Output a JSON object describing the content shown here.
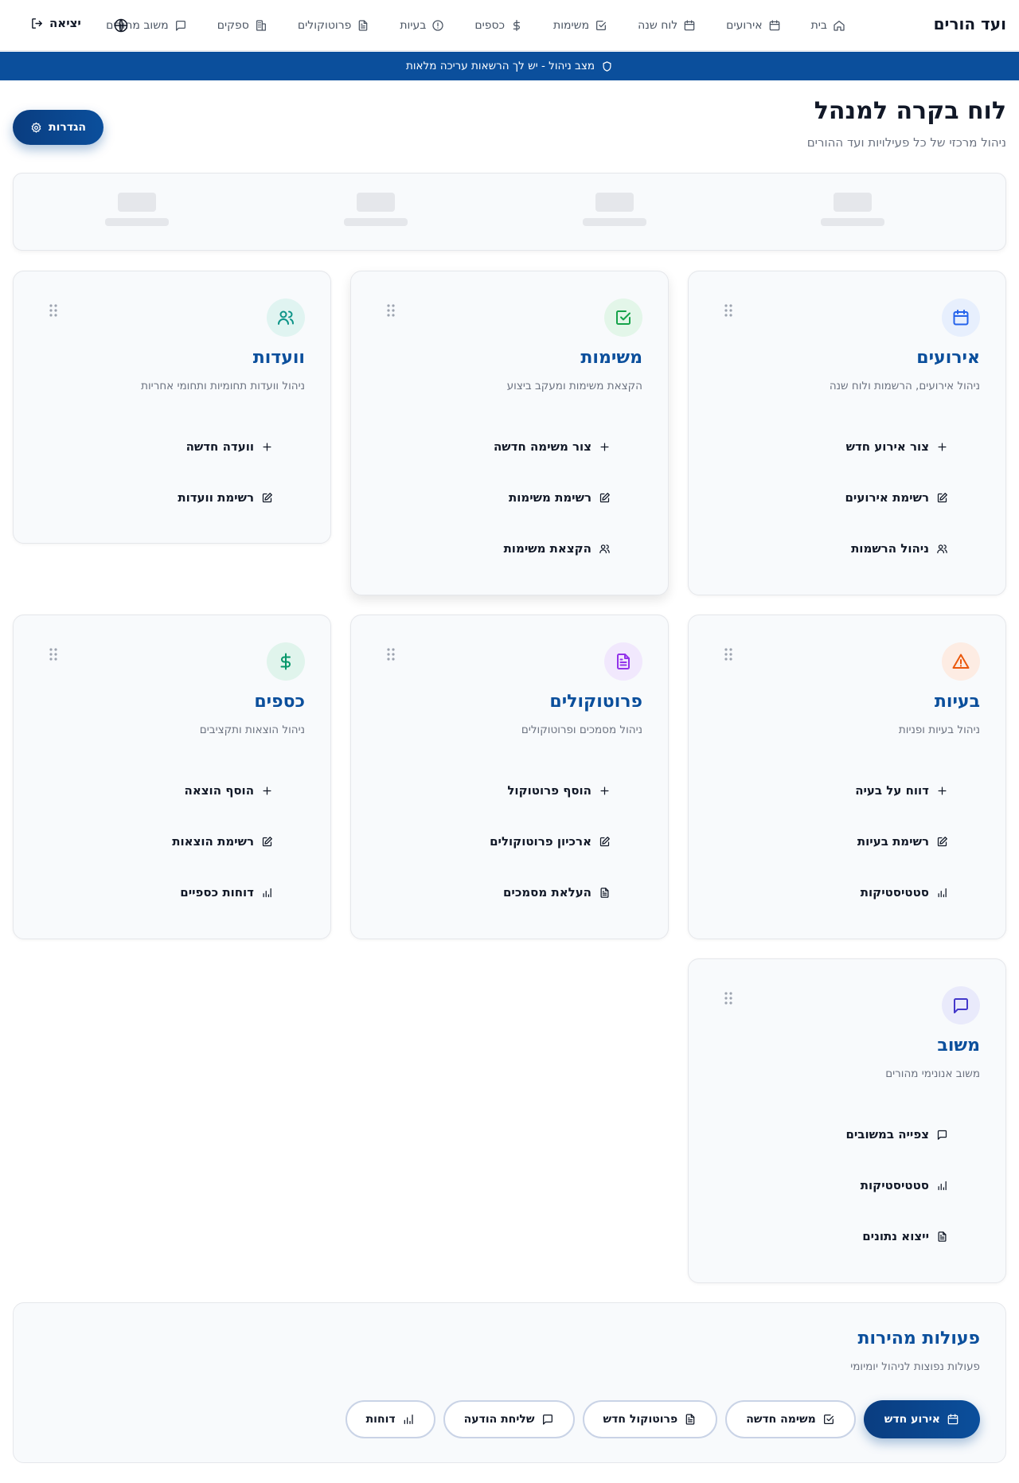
{
  "nav": {
    "brand": "ועד הורים",
    "items": [
      {
        "label": "בית",
        "icon": "home-icon"
      },
      {
        "label": "אירועים",
        "icon": "calendar-icon"
      },
      {
        "label": "לוח שנה",
        "icon": "calendar-icon"
      },
      {
        "label": "משימות",
        "icon": "checkbox-icon"
      },
      {
        "label": "כספים",
        "icon": "dollar-icon"
      },
      {
        "label": "בעיות",
        "icon": "alert-circle-icon"
      },
      {
        "label": "פרוטוקולים",
        "icon": "document-icon"
      },
      {
        "label": "ספקים",
        "icon": "building-icon"
      },
      {
        "label": "משוב מהורים",
        "icon": "message-icon"
      }
    ],
    "logout": "יציאה"
  },
  "banner": {
    "text": "מצב ניהול - יש לך הרשאות עריכה מלאות"
  },
  "header": {
    "title": "לוח בקרה למנהל",
    "subtitle": "ניהול מרכזי של כל פעילויות ועד ההורים",
    "settings": "הגדרות"
  },
  "cards": [
    {
      "title": "אירועים",
      "desc": "ניהול אירועים, הרשמות ולוח שנה",
      "icon": "calendar-icon",
      "color": "#2563eb",
      "bg": "#e7effd",
      "actions": [
        {
          "label": "צור אירוע חדש",
          "icon": "plus-icon"
        },
        {
          "label": "רשימת אירועים",
          "icon": "edit-icon"
        },
        {
          "label": "ניהול הרשמות",
          "icon": "users-icon"
        }
      ]
    },
    {
      "title": "משימות",
      "desc": "הקצאת משימות ומעקב ביצוע",
      "icon": "checkbox-icon",
      "color": "#16a34a",
      "bg": "#e3f6e9",
      "actions": [
        {
          "label": "צור משימה חדשה",
          "icon": "plus-icon"
        },
        {
          "label": "רשימת משימות",
          "icon": "edit-icon"
        },
        {
          "label": "הקצאת משימות",
          "icon": "users-icon"
        }
      ]
    },
    {
      "title": "וועדות",
      "desc": "ניהול וועדות תחומיות ותחומי אחריות",
      "icon": "users-icon",
      "color": "#0d9488",
      "bg": "#e0f4f1",
      "actions": [
        {
          "label": "וועדה חדשה",
          "icon": "plus-icon"
        },
        {
          "label": "רשימת וועדות",
          "icon": "edit-icon"
        }
      ]
    },
    {
      "title": "בעיות",
      "desc": "ניהול בעיות ופניות",
      "icon": "warning-icon",
      "color": "#ea580c",
      "bg": "#fdece3",
      "actions": [
        {
          "label": "דווח על בעיה",
          "icon": "plus-icon"
        },
        {
          "label": "רשימת בעיות",
          "icon": "edit-icon"
        },
        {
          "label": "סטטיסטיקות",
          "icon": "bar-chart-icon"
        }
      ]
    },
    {
      "title": "פרוטוקולים",
      "desc": "ניהול מסמכים ופרוטוקולים",
      "icon": "document-icon",
      "color": "#9333ea",
      "bg": "#f1e8fd",
      "actions": [
        {
          "label": "הוסף פרוטוקול",
          "icon": "plus-icon"
        },
        {
          "label": "ארכיון פרוטוקולים",
          "icon": "edit-icon"
        },
        {
          "label": "העלאת מסמכים",
          "icon": "document-icon"
        }
      ]
    },
    {
      "title": "כספים",
      "desc": "ניהול הוצאות ותקציבים",
      "icon": "dollar-icon",
      "color": "#059669",
      "bg": "#e0f4ec",
      "actions": [
        {
          "label": "הוסף הוצאה",
          "icon": "plus-icon"
        },
        {
          "label": "רשימת הוצאות",
          "icon": "edit-icon"
        },
        {
          "label": "דוחות כספיים",
          "icon": "bar-chart-icon"
        }
      ]
    },
    {
      "title": "משוב",
      "desc": "משוב אנונימי מהורים",
      "icon": "message-icon",
      "color": "#4338ca",
      "bg": "#e9eafb",
      "actions": [
        {
          "label": "צפייה במשובים",
          "icon": "message-icon"
        },
        {
          "label": "סטטיסטיקות",
          "icon": "bar-chart-icon"
        },
        {
          "label": "ייצוא נתונים",
          "icon": "document-icon"
        }
      ]
    }
  ],
  "quick": {
    "title": "פעולות מהירות",
    "desc": "פעולות נפוצות לניהול יומיומי",
    "buttons": [
      {
        "label": "אירוע חדש",
        "icon": "calendar-icon"
      },
      {
        "label": "משימה חדשה",
        "icon": "checkbox-icon"
      },
      {
        "label": "פרוטוקול חדש",
        "icon": "document-icon"
      },
      {
        "label": "שליחת הודעה",
        "icon": "message-icon"
      },
      {
        "label": "דוחות",
        "icon": "bar-chart-icon"
      }
    ]
  }
}
